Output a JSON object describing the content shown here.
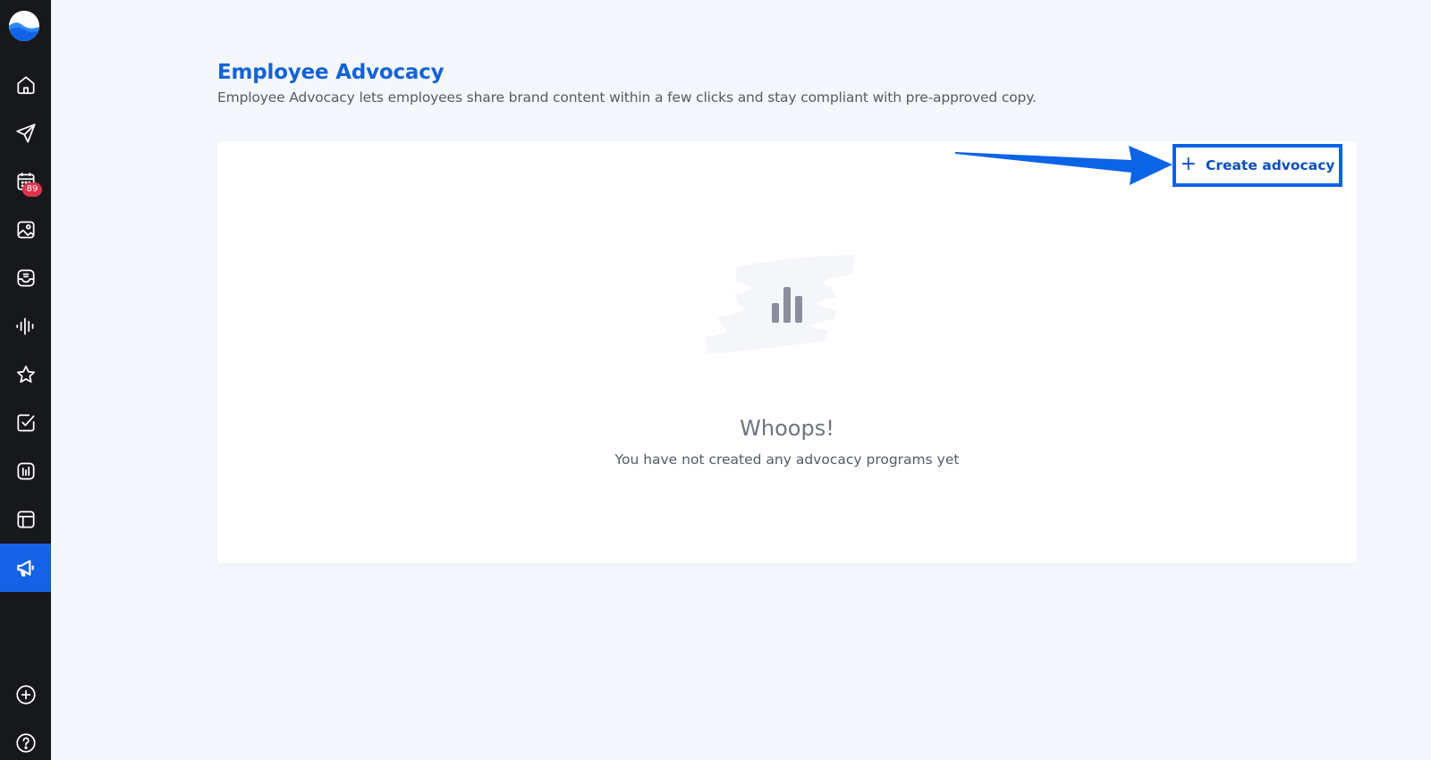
{
  "sidebar": {
    "badge_count": "89",
    "items": [
      {
        "name": "home-icon"
      },
      {
        "name": "send-icon"
      },
      {
        "name": "calendar-icon"
      },
      {
        "name": "media-library-icon"
      },
      {
        "name": "inbox-icon"
      },
      {
        "name": "listening-icon"
      },
      {
        "name": "star-icon"
      },
      {
        "name": "tasks-icon"
      },
      {
        "name": "analytics-icon"
      },
      {
        "name": "layout-icon"
      },
      {
        "name": "megaphone-icon"
      }
    ],
    "bottom": [
      {
        "name": "add-icon"
      },
      {
        "name": "help-icon"
      }
    ],
    "active_color": "#1463e6"
  },
  "header": {
    "title": "Employee Advocacy",
    "subtitle": "Employee Advocacy lets employees share brand content within a few clicks and stay compliant with pre-approved copy."
  },
  "main": {
    "create_button_label": "Create advocacy",
    "empty_title": "Whoops!",
    "empty_description": "You have not created any advocacy programs yet"
  },
  "colors": {
    "accent": "#1363d6",
    "annotation": "#0b63e5",
    "badge": "#e0334d"
  }
}
